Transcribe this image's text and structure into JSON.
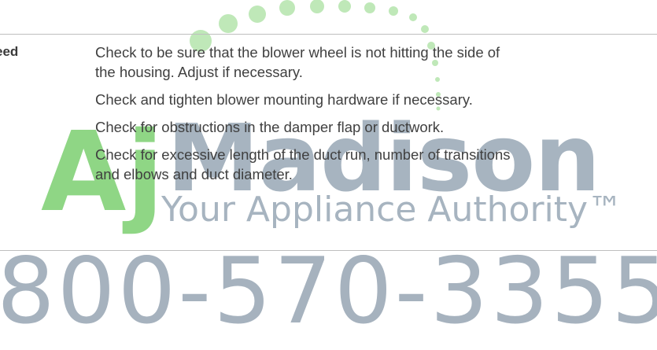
{
  "row": {
    "label": "eed",
    "steps": [
      {
        "lines": [
          "Check to be sure that the blower wheel is not hitting the side of",
          "the housing. Adjust if necessary."
        ]
      },
      {
        "lines": [
          "Check and tighten blower mounting hardware if necessary."
        ]
      },
      {
        "lines": [
          "Check for obstructions in the damper flap or ductwork."
        ]
      },
      {
        "lines": [
          "Check for excessive length of the duct run, number of transitions",
          "and elbows and duct diameter."
        ]
      }
    ]
  },
  "watermark": {
    "logo_prefix": "Aj",
    "brand": "Madison",
    "tagline": "Your Appliance Authority™",
    "phone": "800-570-3355",
    "colors": {
      "green": "#8fd685",
      "blue_gray": "#a7b4c0",
      "dots": "#bfe8b8"
    }
  }
}
